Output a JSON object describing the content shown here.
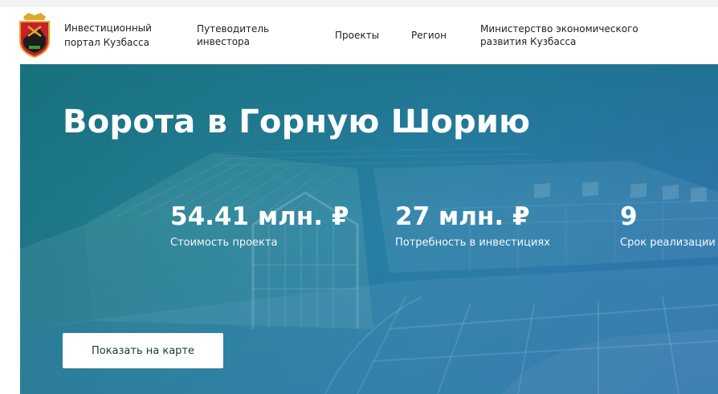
{
  "header": {
    "portal_name": "Инвестиционный портал Кузбасса",
    "logo_icon": "kuzbass-coat-of-arms-icon",
    "nav": {
      "guide": "Путеводитель инвестора",
      "projects": "Проекты",
      "region": "Регион",
      "ministry": "Министерство экономического развития Кузбасса"
    }
  },
  "hero": {
    "title": "Ворота в Горную Шорию",
    "stats": [
      {
        "value": "54.41 млн. ₽",
        "label": "Стоимость проекта"
      },
      {
        "value": "27 млн. ₽",
        "label": "Потребность в инвестициях"
      },
      {
        "value": "9",
        "label": "Срок реализации"
      }
    ],
    "map_button_label": "Показать на карте"
  },
  "colors": {
    "hero_teal": "#1b7480",
    "hero_blue": "#2f74b0",
    "button_text": "#1e3a30",
    "logo_red": "#c8202a",
    "logo_gold": "#e0a82a"
  }
}
